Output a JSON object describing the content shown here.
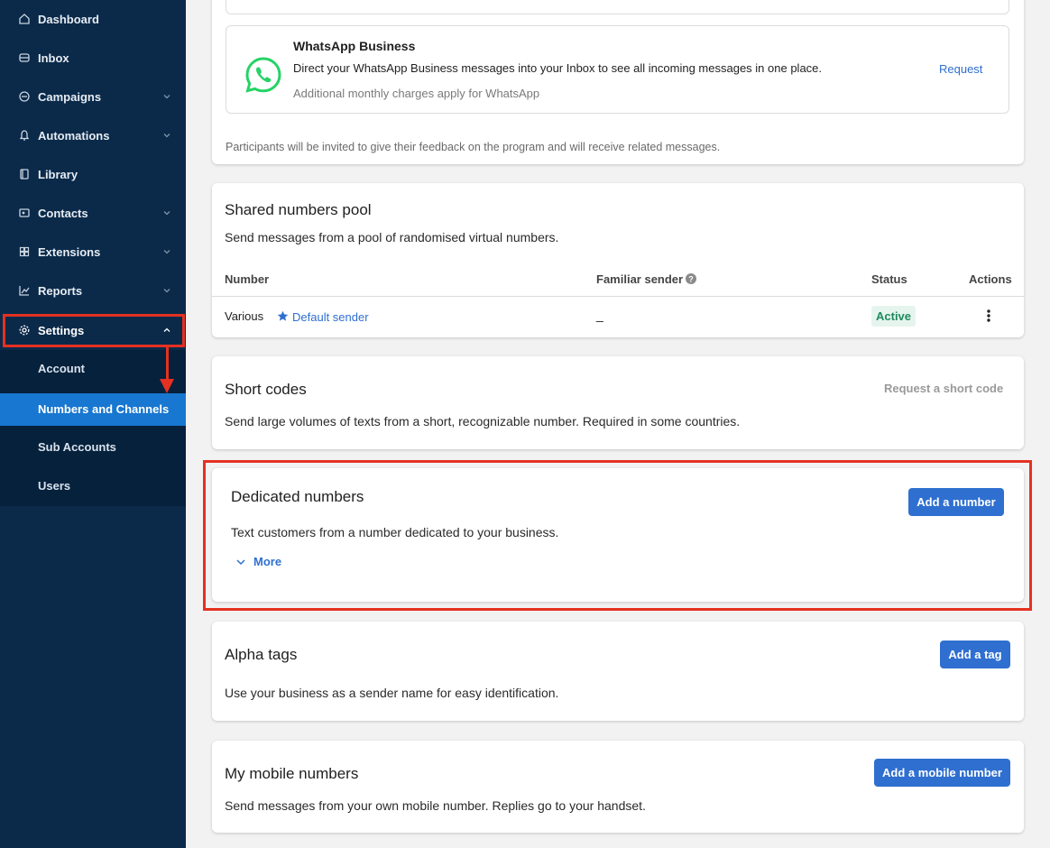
{
  "sidebar": {
    "items": [
      {
        "label": "Dashboard",
        "icon": "home-icon"
      },
      {
        "label": "Inbox",
        "icon": "inbox-icon"
      },
      {
        "label": "Campaigns",
        "icon": "campaigns-icon"
      },
      {
        "label": "Automations",
        "icon": "automations-icon"
      },
      {
        "label": "Library",
        "icon": "library-icon"
      },
      {
        "label": "Contacts",
        "icon": "contacts-icon"
      },
      {
        "label": "Extensions",
        "icon": "extensions-icon"
      },
      {
        "label": "Reports",
        "icon": "reports-icon"
      },
      {
        "label": "Settings",
        "icon": "gear-icon"
      }
    ],
    "settings_sub": [
      {
        "label": "Account"
      },
      {
        "label": "Numbers and Channels"
      },
      {
        "label": "Sub Accounts"
      },
      {
        "label": "Users"
      }
    ]
  },
  "whatsapp": {
    "title": "WhatsApp Business",
    "description": "Direct your WhatsApp Business messages into your Inbox to see all incoming messages in one place.",
    "note": "Additional monthly charges apply for WhatsApp",
    "action": "Request",
    "footer": "Participants will be invited to give their feedback on the program and will receive related messages."
  },
  "shared_pool": {
    "title": "Shared numbers pool",
    "description": "Send messages from a pool of randomised virtual numbers.",
    "columns": [
      "Number",
      "Familiar sender",
      "Status",
      "Actions"
    ],
    "row": {
      "number": "Various",
      "default_sender": "Default sender",
      "familiar": "_",
      "status": "Active"
    }
  },
  "short_codes": {
    "title": "Short codes",
    "description": "Send large volumes of texts from a short, recognizable number. Required in some countries.",
    "action": "Request a short code"
  },
  "dedicated": {
    "title": "Dedicated numbers",
    "description": "Text customers from a number dedicated to your business.",
    "more": "More",
    "action": "Add a number"
  },
  "alpha_tags": {
    "title": "Alpha tags",
    "description": "Use your business as a sender name for easy identification.",
    "action": "Add a tag"
  },
  "mobile": {
    "title": "My mobile numbers",
    "description": "Send messages from your own mobile number. Replies go to your handset.",
    "action": "Add a mobile number"
  },
  "colors": {
    "sidebar": "#0b2a4a",
    "active": "#1877d0",
    "primary": "#2f6fd0",
    "highlight": "#e53121",
    "whatsapp": "#25d366"
  }
}
